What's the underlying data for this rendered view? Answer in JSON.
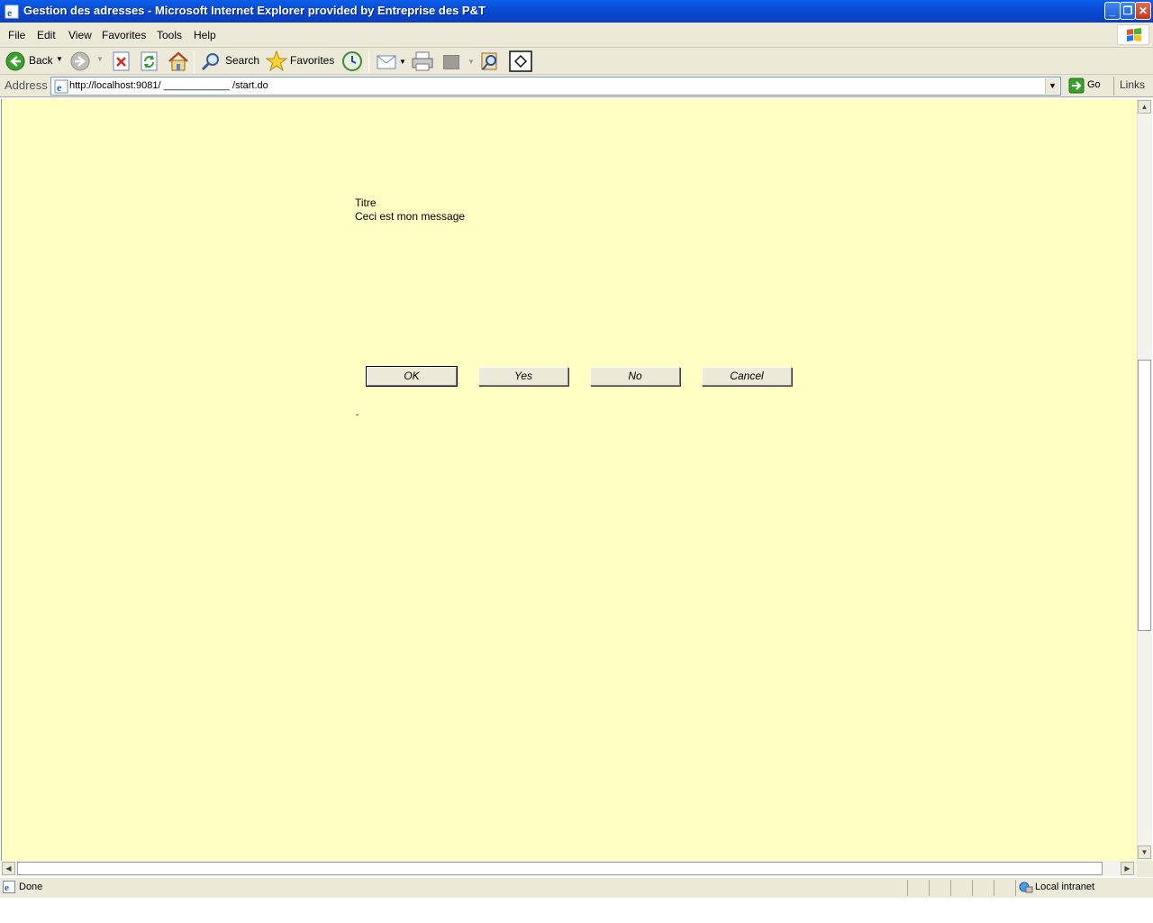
{
  "window": {
    "title": "Gestion des adresses - Microsoft Internet Explorer provided by Entreprise des P&T"
  },
  "menubar": {
    "items": [
      "File",
      "Edit",
      "View",
      "Favorites",
      "Tools",
      "Help"
    ]
  },
  "toolbar": {
    "back_label": "Back",
    "search_label": "Search",
    "favorites_label": "Favorites",
    "icons": [
      "back-icon",
      "forward-icon",
      "stop-icon",
      "refresh-icon",
      "home-icon",
      "search-icon",
      "favorites-icon",
      "history-icon",
      "mail-icon",
      "print-icon",
      "edit-icon",
      "research-icon",
      "messenger-icon"
    ]
  },
  "addressbar": {
    "label": "Address",
    "url": "http://localhost:9081/ ____________ /start.do",
    "go_label": "Go",
    "links_label": "Links"
  },
  "page": {
    "title": "Titre",
    "message": "Ceci est mon message",
    "footer_text": "-",
    "buttons": {
      "ok": "OK",
      "yes": "Yes",
      "no": "No",
      "cancel": "Cancel"
    },
    "background_color": "#ffffc3"
  },
  "statusbar": {
    "status": "Done",
    "zone": "Local intranet"
  }
}
